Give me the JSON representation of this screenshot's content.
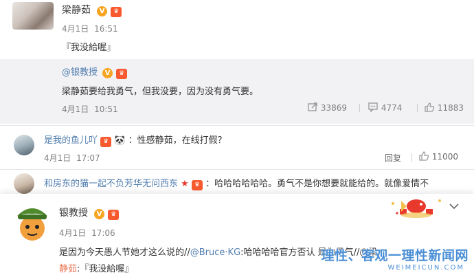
{
  "post": {
    "author": "梁静茹",
    "date": "4月1日",
    "time": "16:51",
    "content": "『我没給喔』",
    "repost": {
      "author": "@银教授",
      "text": "梁静茹要给我勇气，但我没要，因为没有勇气要。",
      "date": "4月1日",
      "time": "10:51",
      "shares": "33869",
      "comments": "4774",
      "likes": "11883"
    }
  },
  "comments": [
    {
      "user": "是我的鱼儿吖",
      "text": "：性感静茹，在线打假？",
      "date": "4月1日",
      "time": "17:07",
      "reply_label": "回复",
      "likes": "11000"
    },
    {
      "user": "和房东的猫一起不负芳华无问西东",
      "text": "：哈哈哈哈哈哈。勇气不是你想要就能给的。就像爱情不"
    }
  ],
  "card": {
    "author": "银教授",
    "date": "4月1日",
    "time": "17:06",
    "text_prefix": "是因为今天愚人节她才这么说的//",
    "mention": "@Bruce·KG",
    "text_suffix": ":哈哈哈哈官方否认 是为勇气//@梁",
    "quote_name": "静茹",
    "quote_text": ":『我没給喔』"
  },
  "watermark": {
    "main": "理性、客观一理性新闻网",
    "sub": "WEIMEICUN.COM"
  },
  "colors": {
    "link_orange": "#eb7350",
    "mention_blue": "#507daf",
    "verified_gold": "#f6a623",
    "vip_red": "#f85a2f"
  }
}
